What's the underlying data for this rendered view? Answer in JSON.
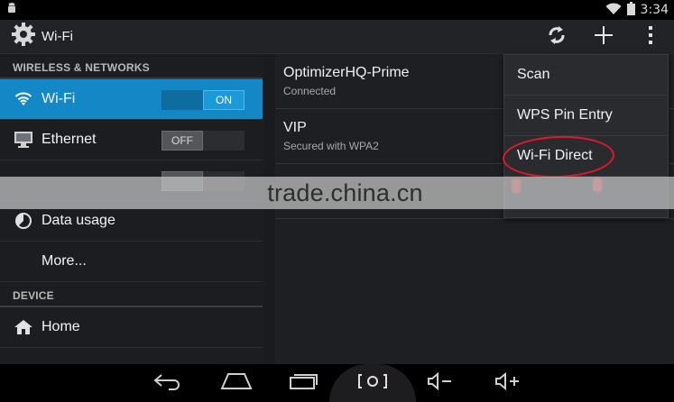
{
  "status_bar": {
    "time": "3:34",
    "icons": [
      "android-debug-icon",
      "wifi-signal-icon",
      "battery-icon"
    ]
  },
  "action_bar": {
    "title": "Wi-Fi",
    "icons": [
      "settings-gear-icon",
      "wps-push-icon",
      "add-icon",
      "overflow-menu-icon"
    ]
  },
  "sidebar": {
    "sections": {
      "wireless": "WIRELESS & NETWORKS",
      "device": "DEVICE"
    },
    "items": [
      {
        "label": "Wi-Fi",
        "toggle": "ON",
        "selected": true
      },
      {
        "label": "Ethernet",
        "toggle": "OFF",
        "selected": false
      },
      {
        "label": "Data usage"
      },
      {
        "label": "More..."
      },
      {
        "label": "Home"
      }
    ]
  },
  "networks": [
    {
      "name": "OptimizerHQ-Prime",
      "status": "Connected"
    },
    {
      "name": "VIP",
      "status": "Secured with WPA2"
    }
  ],
  "overflow_menu": {
    "items": [
      "Scan",
      "WPS Pin Entry",
      "Wi-Fi Direct"
    ]
  },
  "watermark": {
    "text": "trade.china.cn"
  },
  "colors": {
    "accent": "#1488c6",
    "annotation": "#e01a2a"
  }
}
